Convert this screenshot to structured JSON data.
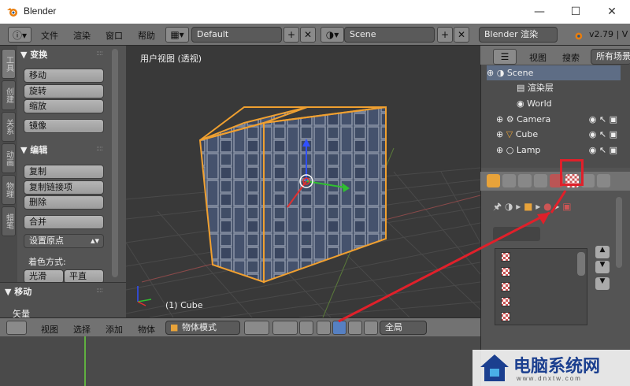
{
  "window": {
    "title": "Blender",
    "minimize_icon": "minimize-icon",
    "maximize_icon": "maximize-icon",
    "close_icon": "close-icon"
  },
  "infobar": {
    "menus": [
      "文件",
      "渲染",
      "窗口",
      "帮助"
    ],
    "screen_layout": "Default",
    "scene": "Scene",
    "render_engine": "Blender 渲染",
    "version": "v2.79 | V"
  },
  "toolshelf": {
    "tabs": [
      "工具",
      "创建",
      "关系",
      "动画",
      "物理",
      "蜡笔"
    ],
    "transform_header": "变换",
    "transform_buttons": [
      "移动",
      "旋转",
      "缩放"
    ],
    "mirror_button": "镜像",
    "edit_header": "编辑",
    "edit_buttons": [
      "复制",
      "复制链接项",
      "删除"
    ],
    "join_button": "合并",
    "set_origin": "设置原点",
    "shading_label": "着色方式:",
    "shading_smooth": "光滑",
    "shading_flat": "平直",
    "operator_header": "移动",
    "vector_label": "矢量"
  },
  "viewport": {
    "view_label": "用户视图 (透视)",
    "object_label": "(1) Cube"
  },
  "viewport_header": {
    "menus": [
      "视图",
      "选择",
      "添加",
      "物体"
    ],
    "mode": "物体模式",
    "orientation": "全局"
  },
  "outliner": {
    "menus": [
      "视图",
      "搜索"
    ],
    "filter": "所有场景",
    "items": [
      {
        "label": "Scene",
        "icon": "scene-icon"
      },
      {
        "label": "渲染层",
        "icon": "render-layers-icon"
      },
      {
        "label": "World",
        "icon": "world-icon"
      },
      {
        "label": "Camera",
        "icon": "camera-icon"
      },
      {
        "label": "Cube",
        "icon": "mesh-icon"
      },
      {
        "label": "Lamp",
        "icon": "lamp-icon"
      }
    ]
  },
  "properties": {
    "active_tab": "texture-tab",
    "highlight_color": "#e0202a"
  },
  "watermark": {
    "text": "电脑系统网",
    "sub": "www.dnxtw.com"
  }
}
